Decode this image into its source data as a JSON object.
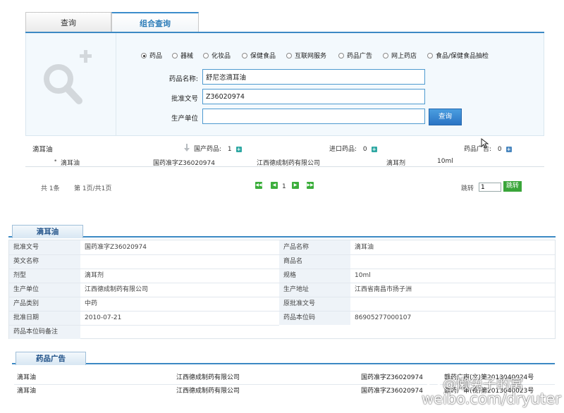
{
  "tabs": {
    "query": "查询",
    "combo": "组合查询"
  },
  "categories": [
    {
      "label": "药品",
      "selected": true
    },
    {
      "label": "器械",
      "selected": false
    },
    {
      "label": "化妆品",
      "selected": false
    },
    {
      "label": "保健食品",
      "selected": false
    },
    {
      "label": "互联网服务",
      "selected": false
    },
    {
      "label": "药品广告",
      "selected": false
    },
    {
      "label": "网上药店",
      "selected": false
    },
    {
      "label": "食品/保健食品抽检",
      "selected": false
    }
  ],
  "form": {
    "drug_name_label": "药品名称:",
    "drug_name_value": "舒尼恣滴耳油",
    "approval_label": "批准文号",
    "approval_value": "Z36020974",
    "maker_label": "生产单位",
    "maker_value": "",
    "search_button": "查询"
  },
  "results_header": {
    "name": "滴耳油",
    "domestic_label": "国产药品:",
    "domestic_count": "1",
    "import_label": "进口药品:",
    "import_count": "0",
    "ad_label": "药品广告:",
    "ad_count": "0"
  },
  "result_row": {
    "name": "滴耳油",
    "approval": "国药准字Z36020974",
    "company": "江西德成制药有限公司",
    "form": "滴耳剂",
    "spec": "10ml"
  },
  "pagination": {
    "total": "共 1条",
    "page_info": "第 1页/共1页",
    "current": "1",
    "jump_label": "跳转",
    "jump_value": "1",
    "jump_button": "跳转"
  },
  "detail": {
    "title": "滴耳油",
    "left": [
      {
        "key": "批准文号",
        "value": "国药准字Z36020974"
      },
      {
        "key": "英文名称",
        "value": ""
      },
      {
        "key": "剂型",
        "value": "滴耳剂"
      },
      {
        "key": "生产单位",
        "value": "江西德成制药有限公司"
      },
      {
        "key": "产品类别",
        "value": "中药"
      },
      {
        "key": "批准日期",
        "value": "2010-07-21"
      },
      {
        "key": "药品本位码备注",
        "value": ""
      }
    ],
    "right": [
      {
        "key": "产品名称",
        "value": "滴耳油"
      },
      {
        "key": "商品名",
        "value": ""
      },
      {
        "key": "规格",
        "value": "10ml"
      },
      {
        "key": "生产地址",
        "value": "江西省南昌市扬子洲"
      },
      {
        "key": "原批准文号",
        "value": ""
      },
      {
        "key": "药品本位码",
        "value": "86905277000107"
      }
    ]
  },
  "ads": {
    "title": "药品广告",
    "rows": [
      {
        "name": "滴耳油",
        "company": "江西德成制药有限公司",
        "approval": "国药准字Z36020974",
        "ad_no": "赣药广审(文)第2013040024号"
      },
      {
        "name": "滴耳油",
        "company": "江西德成制药有限公司",
        "approval": "国药准字Z36020974",
        "ad_no": "赣药广审(视)第2013040023号"
      }
    ]
  },
  "watermark": {
    "handle": "@懒兔子的窝",
    "site": "weibo.com/dryuter"
  },
  "colors": {
    "accent": "#3c89c4",
    "button": "#2a74c4",
    "green": "#3cae3c"
  }
}
